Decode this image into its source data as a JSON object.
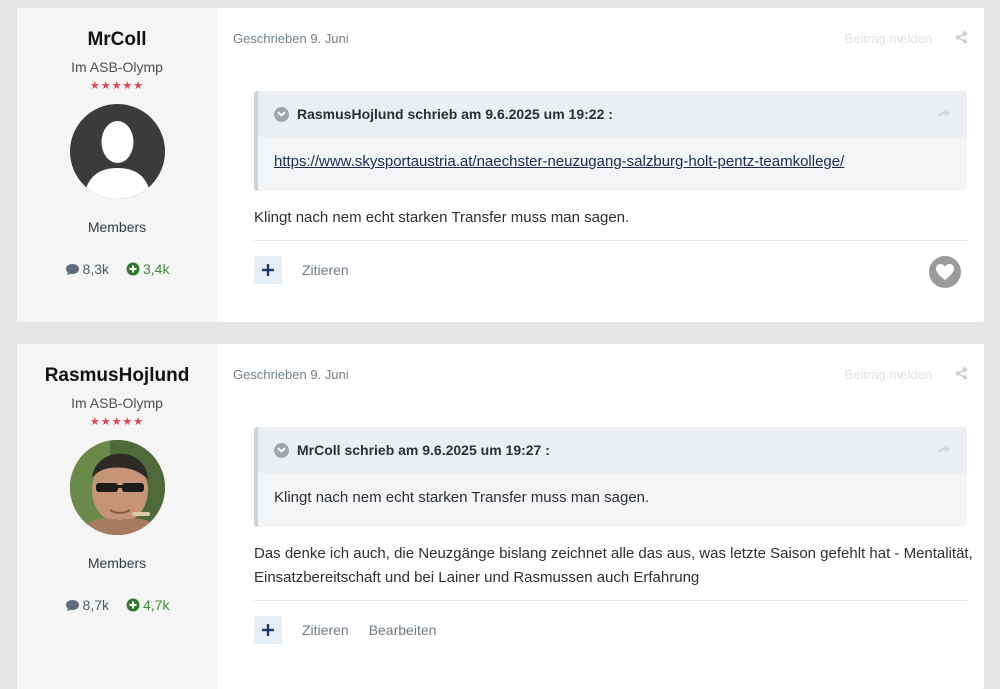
{
  "colors": {
    "page_bg": "#e5e5e5",
    "author_bg": "#f5f5f5",
    "stars": "#e0434b",
    "rep": "#3f8a3a",
    "link": "#1a2a55"
  },
  "posts": [
    {
      "author": {
        "name": "MrColl",
        "group": "Im ASB-Olymp",
        "stars": "★★★★★",
        "avatar_icon": "default-user-silhouette",
        "role": "Members",
        "posts_count": "8,3k",
        "reputation": "3,4k"
      },
      "date": "Geschrieben 9. Juni",
      "report_label": "Beitrag melden",
      "quote": {
        "header": "RasmusHojlund schrieb am 9.6.2025 um 19:22 :",
        "body": "https://www.skysportaustria.at/naechster-neuzugang-salzburg-holt-pentz-teamkollege/"
      },
      "text": "Klingt nach nem echt starken Transfer muss man sagen.",
      "actions": {
        "quote_label": "Zitieren"
      }
    },
    {
      "author": {
        "name": "RasmusHojlund",
        "group": "Im ASB-Olymp",
        "stars": "★★★★★",
        "avatar_icon": "user-photo",
        "role": "Members",
        "posts_count": "8,7k",
        "reputation": "4,7k"
      },
      "date": "Geschrieben 9. Juni",
      "report_label": "Beitrag melden",
      "quote": {
        "header": "MrColl schrieb am 9.6.2025 um 19:27 :",
        "body": "Klingt nach nem echt starken Transfer muss man sagen."
      },
      "text": "Das denke ich auch, die Neuzgänge bislang zeichnet alle das aus, was letzte Saison gefehlt hat - Mentalität, Einsatzbereitschaft und bei Lainer und Rasmussen auch Erfahrung",
      "actions": {
        "quote_label": "Zitieren",
        "edit_label": "Bearbeiten"
      }
    }
  ]
}
